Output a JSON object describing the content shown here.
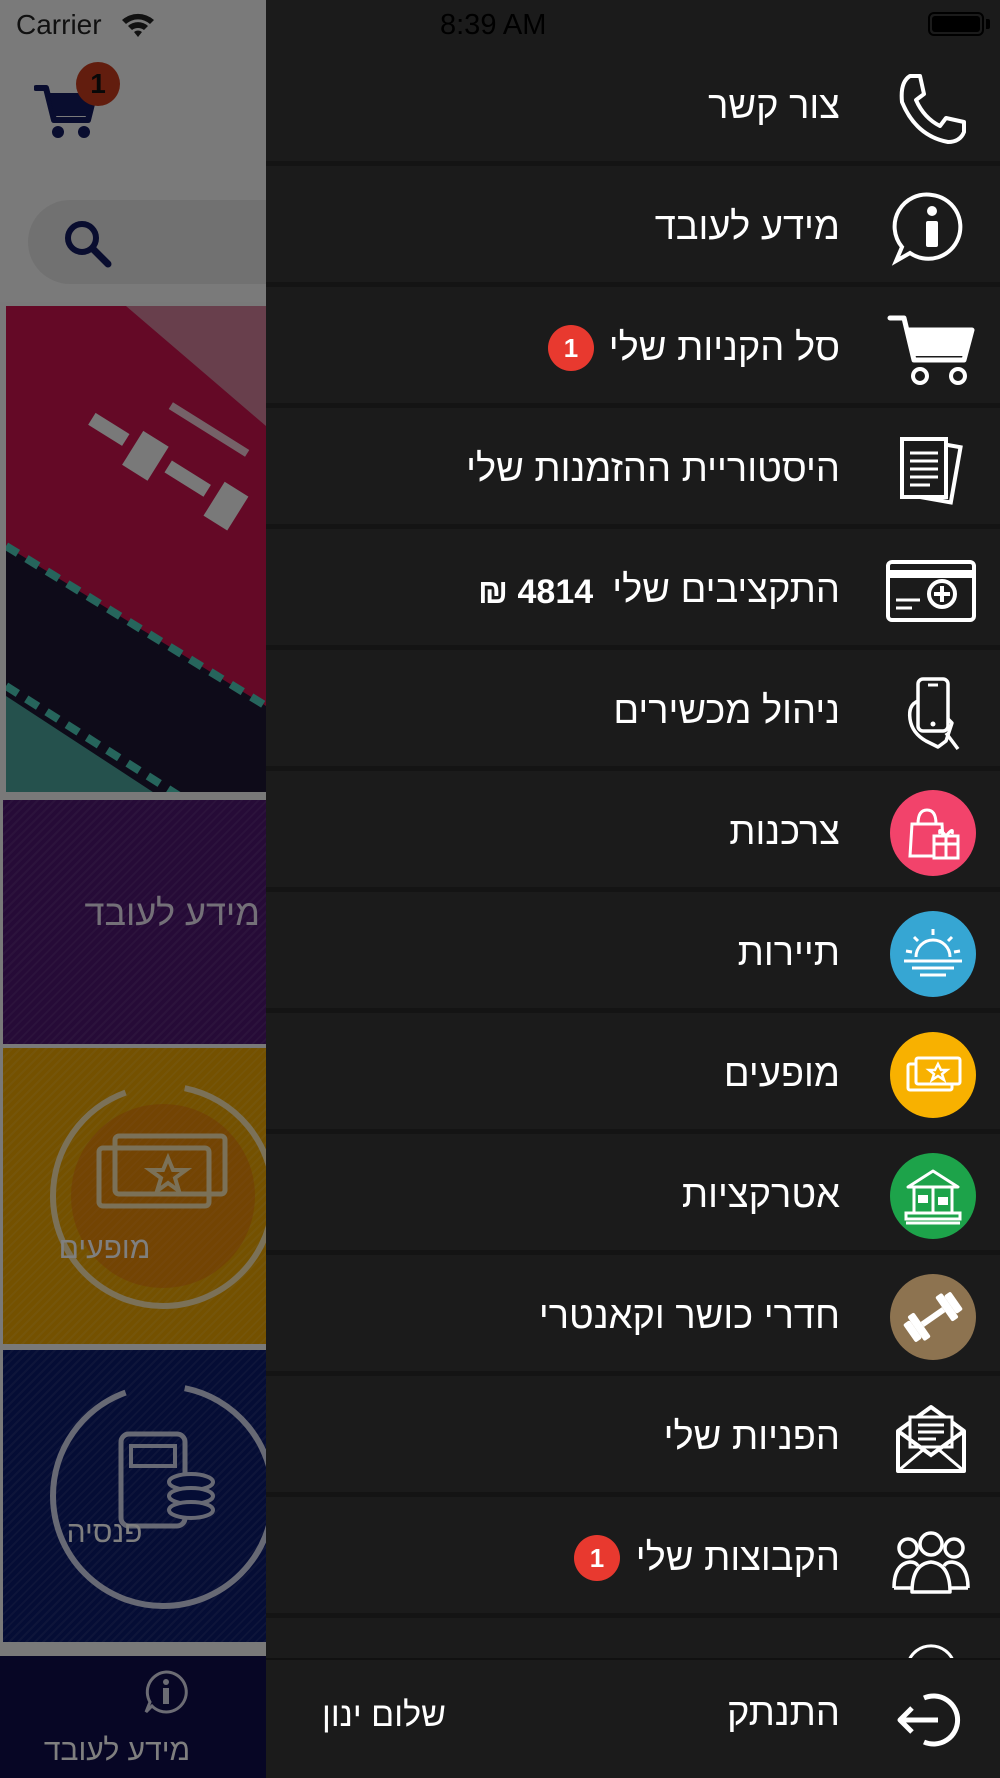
{
  "status_bar": {
    "carrier": "Carrier",
    "time": "8:39 AM"
  },
  "background": {
    "cart_count": "1",
    "tile_info_label": "מידע לעובד",
    "tile_shows_label": "מופעים",
    "tile_pension_label": "פנסיה",
    "bottom_tab_label": "מידע לעובד"
  },
  "drawer": {
    "items": [
      {
        "label": "צור קשר",
        "icon": "phone-icon"
      },
      {
        "label": "מידע לעובד",
        "icon": "info-bubble-icon"
      },
      {
        "label": "סל הקניות שלי",
        "icon": "cart-icon",
        "badge": "1"
      },
      {
        "label": "היסטוריית ההזמנות שלי",
        "icon": "documents-icon"
      },
      {
        "label": "התקציבים שלי",
        "icon": "credit-card-plus-icon",
        "value": "4814 ₪"
      },
      {
        "label": "ניהול מכשירים",
        "icon": "phone-in-hand-icon"
      },
      {
        "label": "צרכנות",
        "icon": "shopping-bag-icon",
        "color": "#f2436b"
      },
      {
        "label": "תיירות",
        "icon": "sunrise-icon",
        "color": "#36a6d3"
      },
      {
        "label": "מופעים",
        "icon": "ticket-icon",
        "color": "#f8b100"
      },
      {
        "label": "אטרקציות",
        "icon": "carousel-icon",
        "color": "#1da34a"
      },
      {
        "label": "חדרי כושר וקאנטרי",
        "icon": "dumbbell-icon",
        "color": "#8d7350"
      },
      {
        "label": "הפניות שלי",
        "icon": "envelope-icon"
      },
      {
        "label": "הקבוצות שלי",
        "icon": "group-icon",
        "badge": "1"
      }
    ],
    "footer": {
      "logout_label": "התנתק",
      "greeting": "שלום ינון"
    }
  },
  "colors": {
    "drawer_bg": "#1b1b1b",
    "badge_red": "#e8392f",
    "cart_badge": "#c43a1c"
  }
}
